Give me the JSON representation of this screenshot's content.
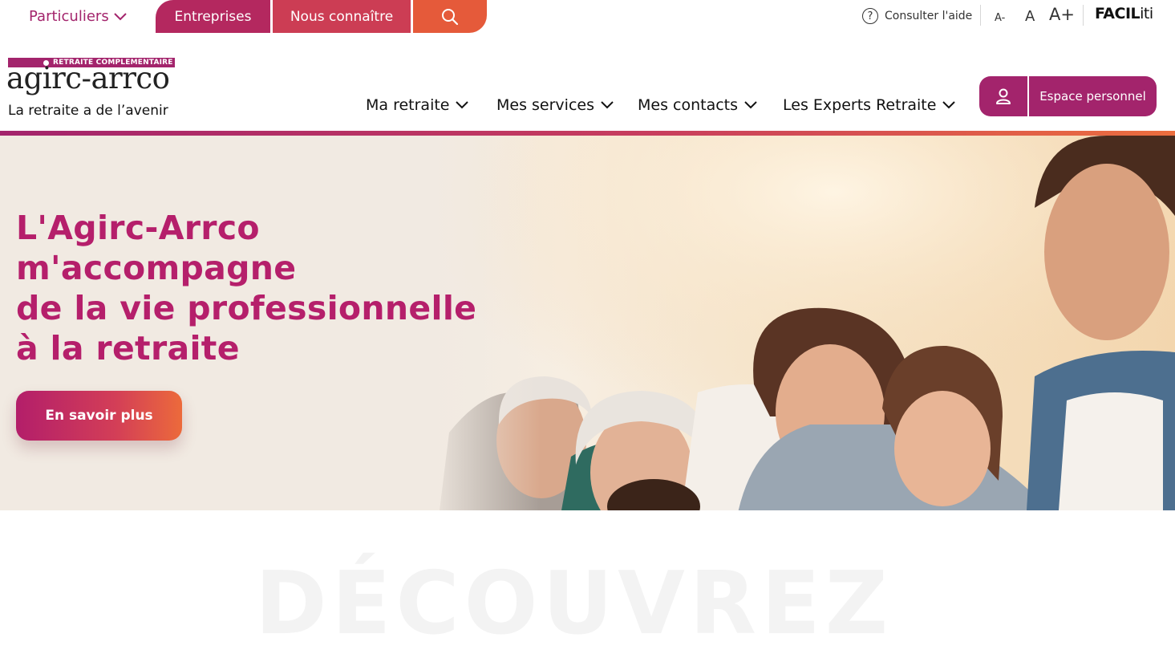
{
  "topbar": {
    "tabs": {
      "particuliers": "Particuliers",
      "entreprises": "Entreprises",
      "nous_connaitre": "Nous connaître"
    },
    "help_label": "Consulter l'aide",
    "font_sizes": {
      "decrease": "A-",
      "default": "A",
      "increase": "A+"
    },
    "faciliti_prefix": "FACIL",
    "faciliti_suffix": "iti"
  },
  "logo": {
    "banner": "RETRAITE COMPLEMENTAIRE",
    "wordmark": "agirc-arrco",
    "tagline": "La retraite a de l’avenir"
  },
  "nav": {
    "items": [
      "Ma retraite",
      "Mes services",
      "Mes contacts",
      "Les Experts Retraite"
    ],
    "espace_label": "Espace personnel"
  },
  "hero": {
    "title_lines": [
      "L'Agirc-Arrco",
      "m'accompagne",
      "de la vie professionnelle",
      "à la retraite"
    ],
    "cta_label": "En savoir plus"
  },
  "section": {
    "heading_partial": "DÉCOUVREZ"
  },
  "colors": {
    "brand_purple": "#a3246c",
    "hero_title": "#b51f6b",
    "tab_entreprises": "#b4285f",
    "tab_nous": "#cc3d54",
    "tab_search": "#e55a3a",
    "accent_orange": "#ec6e3e"
  },
  "icons": {
    "search": "search-icon",
    "help": "help-circle-icon",
    "user": "user-icon",
    "chevron": "chevron-down-icon"
  }
}
